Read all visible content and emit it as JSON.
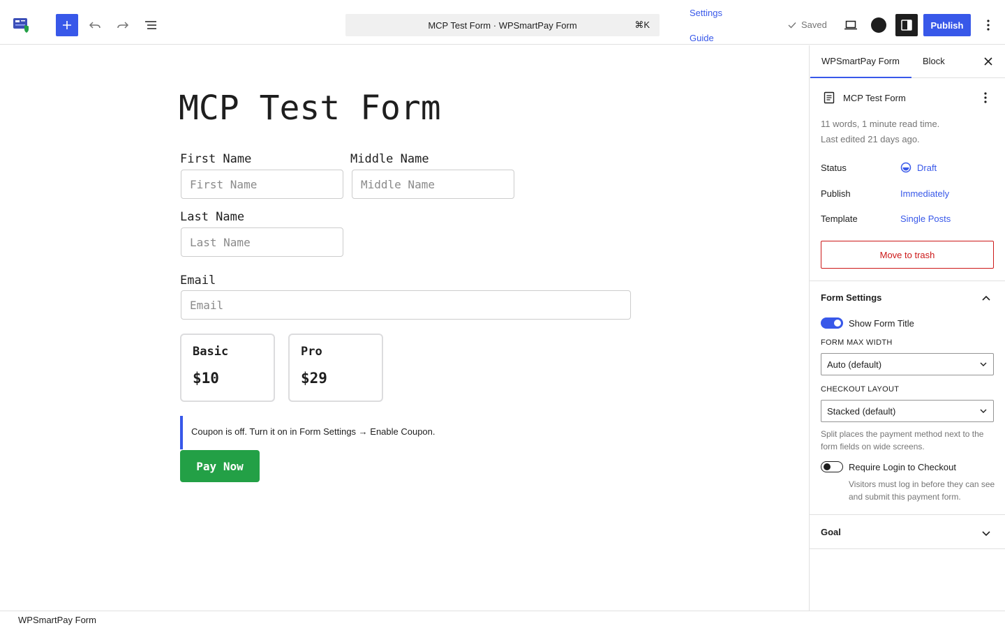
{
  "header": {
    "command_bar": "MCP Test Form · WPSmartPay Form",
    "shortcut": "⌘K",
    "links": [
      "Settings",
      "Guide"
    ],
    "saved": "Saved",
    "publish": "Publish"
  },
  "form": {
    "title": "MCP Test Form",
    "fields": {
      "first": {
        "label": "First Name",
        "placeholder": "First Name"
      },
      "middle": {
        "label": "Middle Name",
        "placeholder": "Middle Name"
      },
      "last": {
        "label": "Last Name",
        "placeholder": "Last Name"
      },
      "email": {
        "label": "Email",
        "placeholder": "Email"
      }
    },
    "prices": [
      {
        "name": "Basic",
        "amount": "$10"
      },
      {
        "name": "Pro",
        "amount": "$29"
      }
    ],
    "coupon_note": "Coupon is off. Turn it on in Form Settings → Enable Coupon.",
    "pay_button": "Pay Now"
  },
  "sidebar": {
    "tabs": [
      "WPSmartPay Form",
      "Block"
    ],
    "doc_title": "MCP Test Form",
    "word_info": "11 words, 1 minute read time.",
    "last_edited": "Last edited 21 days ago.",
    "status": {
      "label": "Status",
      "value": "Draft"
    },
    "publish": {
      "label": "Publish",
      "value": "Immediately"
    },
    "template": {
      "label": "Template",
      "value": "Single Posts"
    },
    "trash": "Move to trash",
    "form_settings": {
      "title": "Form Settings",
      "show_title": "Show Form Title",
      "max_width_label": "FORM MAX WIDTH",
      "max_width_value": "Auto (default)",
      "checkout_layout_label": "CHECKOUT LAYOUT",
      "checkout_layout_value": "Stacked (default)",
      "layout_help": "Split places the payment method next to the form fields on wide screens.",
      "require_login": "Require Login to Checkout",
      "require_login_help": "Visitors must log in before they can see and submit this payment form."
    },
    "goal": "Goal"
  },
  "footer": {
    "breadcrumb": "WPSmartPay Form"
  },
  "colors": {
    "accent": "#3858e9",
    "pay": "#23a046",
    "danger": "#cc1818"
  }
}
